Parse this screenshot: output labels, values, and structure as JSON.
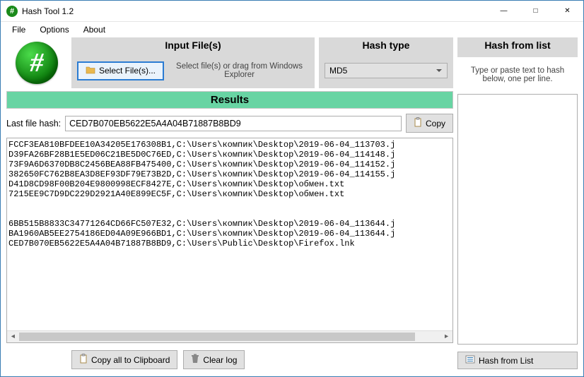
{
  "window": {
    "title": "Hash Tool 1.2",
    "icon_glyph": "#"
  },
  "menu": {
    "file": "File",
    "options": "Options",
    "about": "About"
  },
  "logo_glyph": "#",
  "panels": {
    "input": {
      "header": "Input File(s)",
      "select_button": "Select File(s)...",
      "hint": "Select file(s) or drag from Windows Explorer"
    },
    "hashtype": {
      "header": "Hash type",
      "selected": "MD5"
    },
    "hashfromlist": {
      "header": "Hash from list",
      "hint": "Type or paste text to hash below, one per line.",
      "button": "Hash from List"
    }
  },
  "results": {
    "header": "Results",
    "last_label": "Last file hash:",
    "last_value": "CED7B070EB5622E5A4A04B71887B8BD9",
    "copy_label": "Copy",
    "log_text": "FCCF3EA810BFDEE10A34205E176308B1,C:\\Users\\компик\\Desktop\\2019-06-04_113703.j\nD39FA26BF28B1E5ED06C21BE5D0C76ED,C:\\Users\\компик\\Desktop\\2019-06-04_114148.j\n73F9A6D6370DB8C2456BEA88FB475400,C:\\Users\\компик\\Desktop\\2019-06-04_114152.j\n382650FC762B8EA3D8EF93DF79E73B2D,C:\\Users\\компик\\Desktop\\2019-06-04_114155.j\nD41D8CD98F00B204E9800998ECF8427E,C:\\Users\\компик\\Desktop\\обмен.txt\n7215EE9C7D9DC229D2921A40E899EC5F,C:\\Users\\компик\\Desktop\\обмен.txt\n\n\n6BB515B8833C34771264CD66FC507E32,C:\\Users\\компик\\Desktop\\2019-06-04_113644.j\nBA1960AB5EE2754186ED04A09E966BD1,C:\\Users\\компик\\Desktop\\2019-06-04_113644.j\nCED7B070EB5622E5A4A04B71887B8BD9,C:\\Users\\Public\\Desktop\\Firefox.lnk",
    "copy_all": "Copy all to Clipboard",
    "clear_log": "Clear log"
  }
}
